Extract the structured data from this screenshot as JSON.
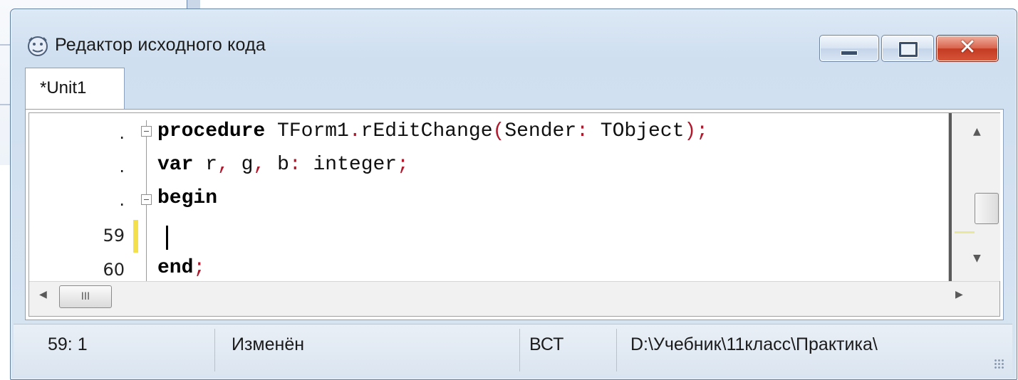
{
  "window": {
    "title": "Редактор исходного кода",
    "icon": "delphi-lion-icon",
    "controls": [
      "minimize",
      "maximize",
      "close"
    ],
    "close_glyph": "✕"
  },
  "tabs": [
    {
      "label": "*Unit1",
      "active": true
    }
  ],
  "editor": {
    "gutter": [
      ".",
      ".",
      ".",
      "59",
      "60"
    ],
    "lines": {
      "line1": {
        "kw": "procedure",
        "rest": " TForm1",
        "dot": ".",
        "name": "rEditChange",
        "p1": "(",
        "arg": "Sender",
        "colon": ":",
        "type": " TObject",
        "p2": ")",
        "semi": ";"
      },
      "line2": {
        "kw": "var",
        "r": " r",
        "c1": ",",
        "g": " g",
        "c2": ",",
        "b": " b",
        "colon": ":",
        "type": " integer",
        "semi": ";"
      },
      "line3": {
        "kw": "begin"
      },
      "line5": {
        "kw": "end",
        "semi": ";"
      }
    },
    "cursor_line": 59,
    "modified_line_color": "#f4e04a"
  },
  "scrollbars": {
    "horizontal_thumb": "III"
  },
  "statusbar": {
    "position": "59:  1",
    "state": "Изменён",
    "mode": "ВСТ",
    "path": "D:\\Учебник\\11класс\\Практика\\"
  },
  "colors": {
    "keyword": "#000000",
    "symbol": "#b0182c",
    "title_bar": "#dce8f5"
  }
}
